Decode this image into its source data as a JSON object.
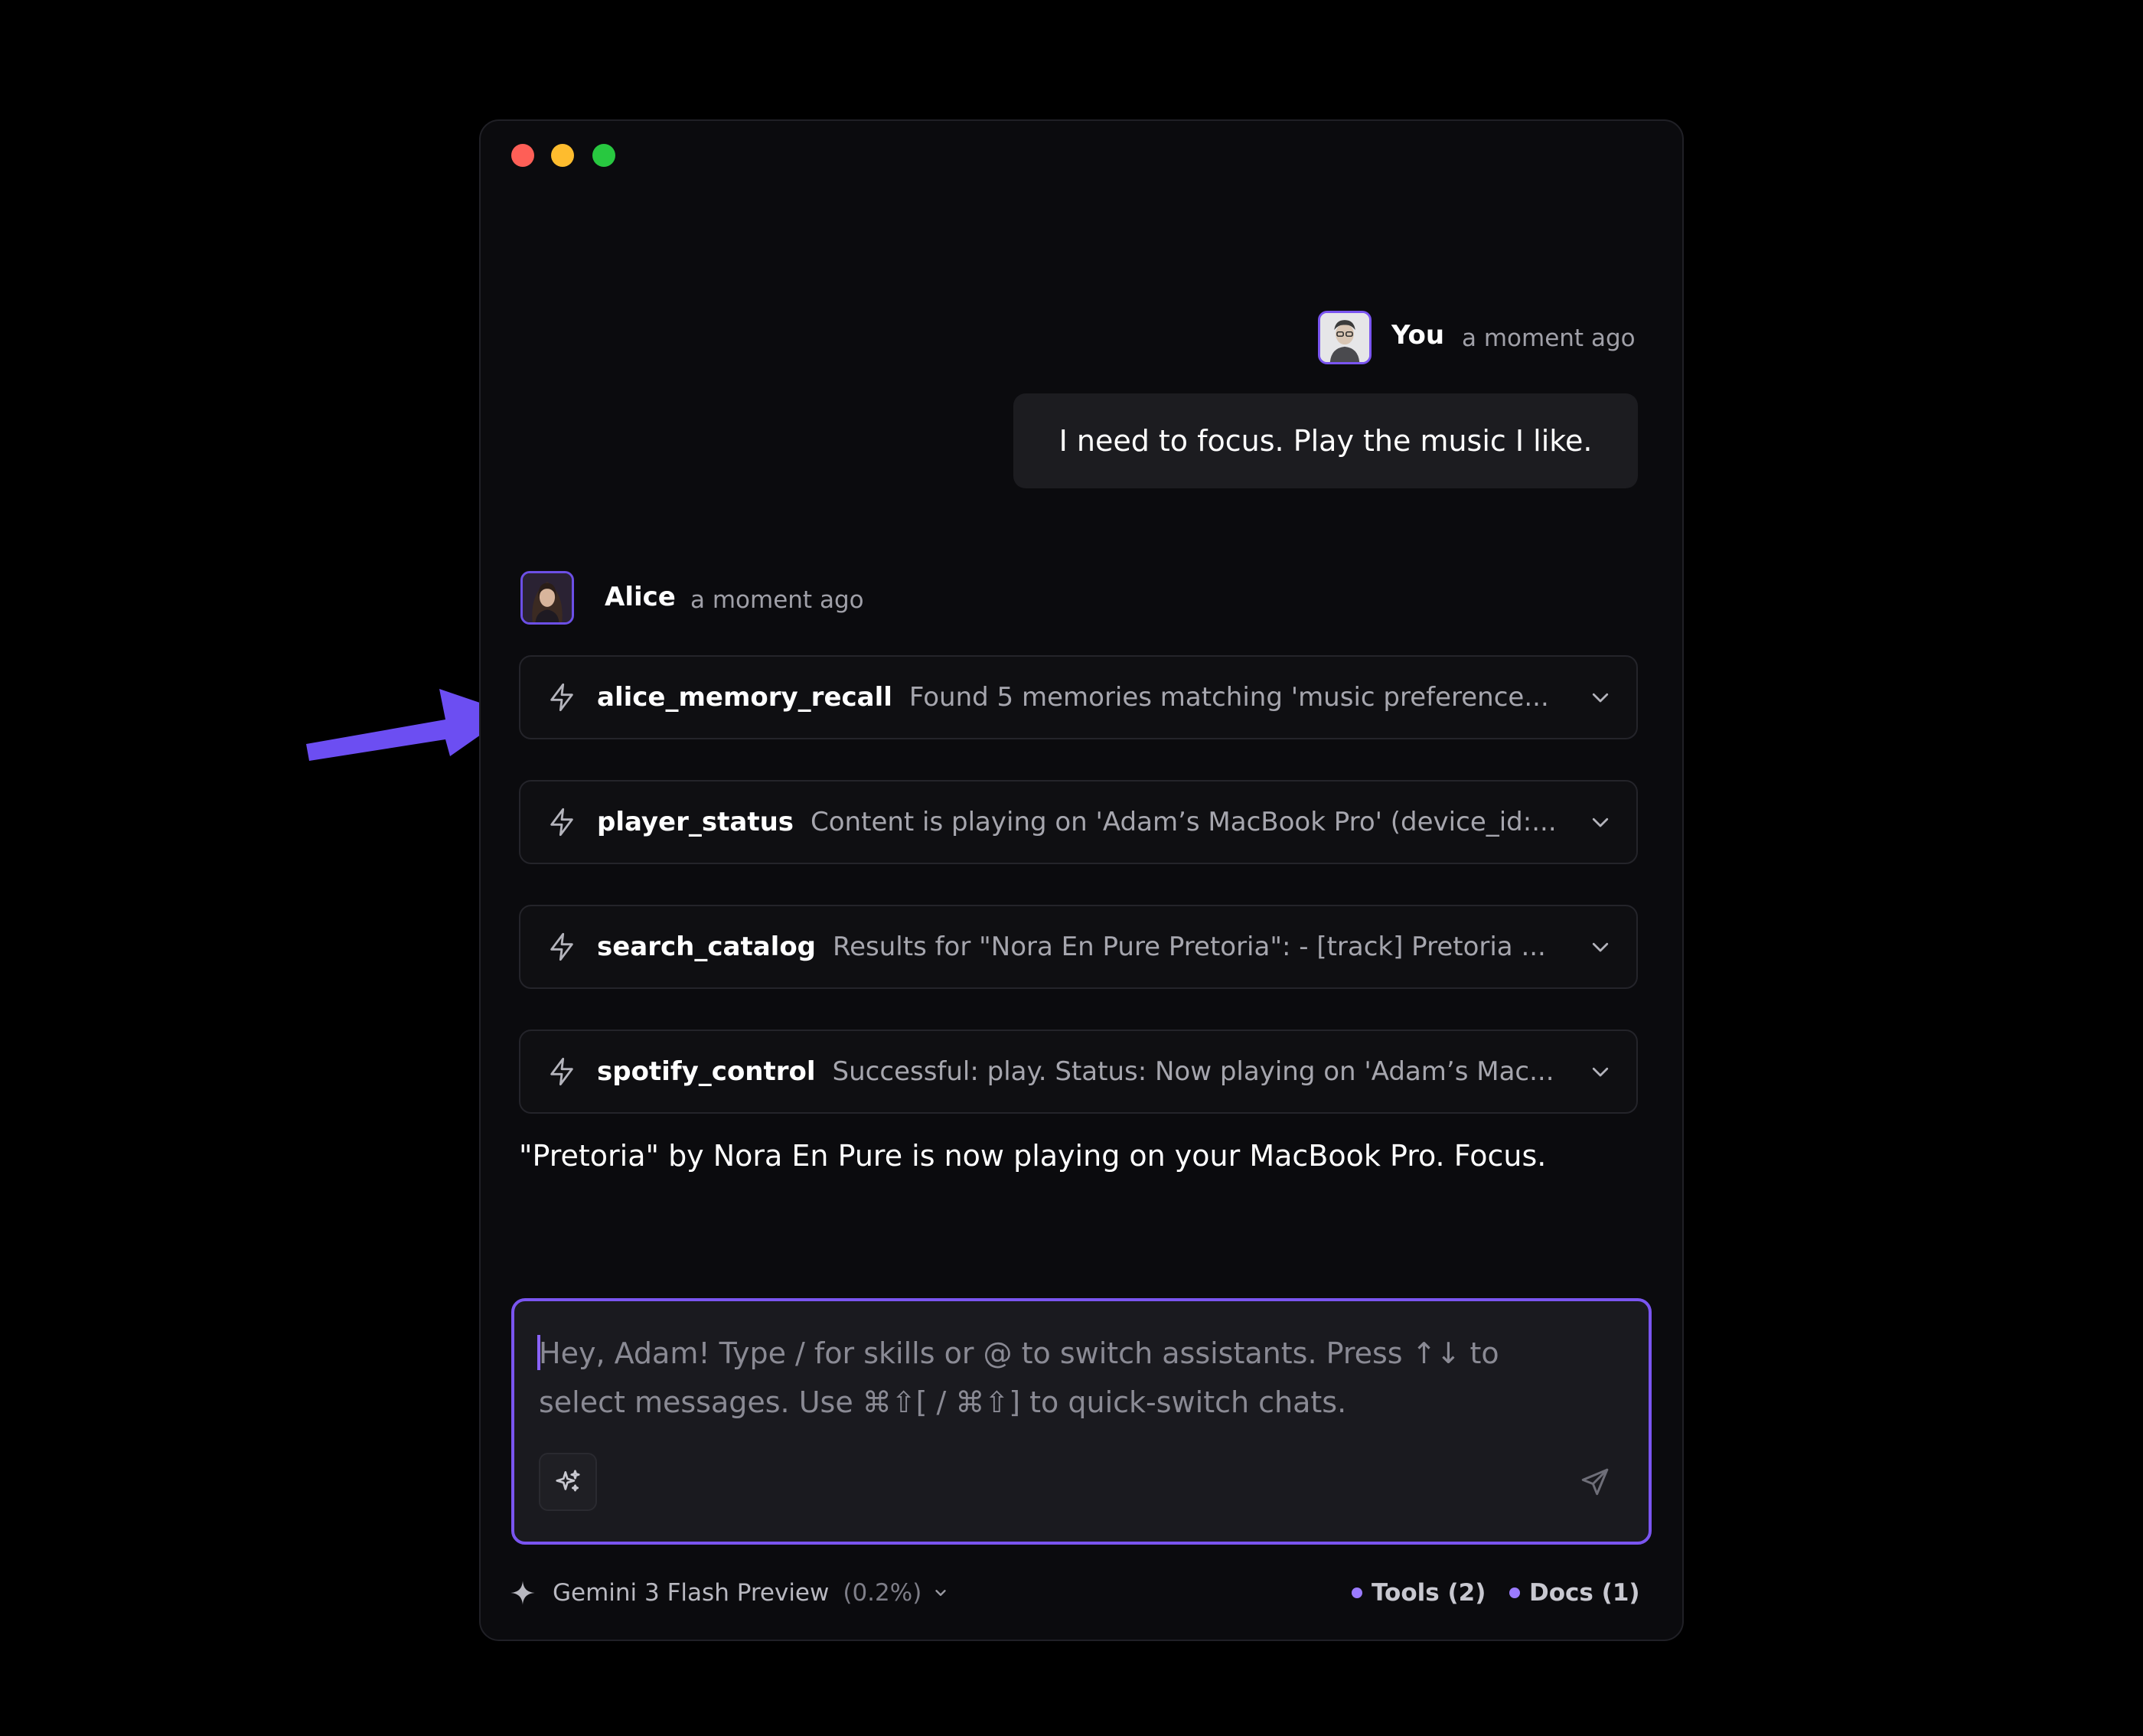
{
  "window": {
    "controls": [
      "close",
      "minimize",
      "maximize"
    ]
  },
  "user_message": {
    "author": "You",
    "timestamp": "a moment ago",
    "text": "I need to focus. Play the music I like."
  },
  "assistant_message": {
    "author": "Alice",
    "timestamp": "a moment ago",
    "tool_calls": [
      {
        "name": "alice_memory_recall",
        "result": "Found 5 memories matching 'music preference..."
      },
      {
        "name": "player_status",
        "result": "Content is playing on 'Adam’s MacBook Pro' (device_id:..."
      },
      {
        "name": "search_catalog",
        "result": "Results for \"Nora En Pure Pretoria\": - [track] Pretoria ..."
      },
      {
        "name": "spotify_control",
        "result": "Successful: play. Status: Now playing on 'Adam’s Mac..."
      }
    ],
    "reply": "\"Pretoria\" by Nora En Pure is now playing on your MacBook Pro. Focus."
  },
  "composer": {
    "placeholder": "Hey, Adam! Type / for skills or @ to switch assistants. Press ↑↓ to\nselect messages. Use ⌘⇧[ / ⌘⇧] to quick-switch chats."
  },
  "footer": {
    "model_name": "Gemini 3 Flash Preview",
    "model_usage": "(0.2%)",
    "tools_label": "Tools (2)",
    "docs_label": "Docs (1)"
  },
  "colors": {
    "accent": "#7a55f0",
    "window_bg": "#0b0b0e",
    "annotation_arrow": "#6c4ef2",
    "close": "#fe5f57",
    "minimize": "#febc2e",
    "maximize": "#28c840"
  },
  "icons": [
    "bolt-icon",
    "chevron-down-icon",
    "sparkles-icon",
    "send-icon",
    "sparkle-icon",
    "annotation-arrow"
  ]
}
